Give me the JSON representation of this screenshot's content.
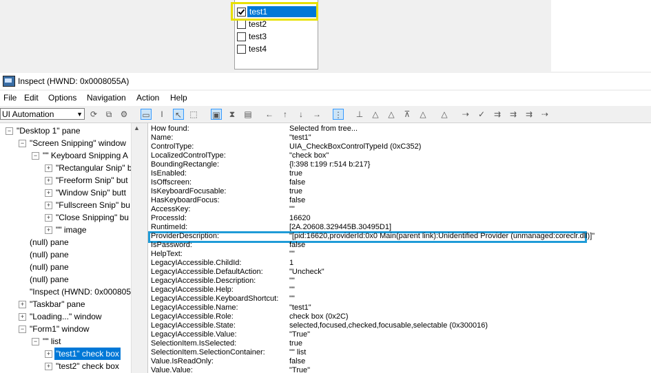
{
  "listbox": {
    "items": [
      {
        "label": "test1",
        "checked": true
      },
      {
        "label": "test2",
        "checked": false
      },
      {
        "label": "test3",
        "checked": false
      },
      {
        "label": "test4",
        "checked": false
      }
    ]
  },
  "window": {
    "title": "Inspect  (HWND: 0x0008055A)"
  },
  "menu": [
    "File",
    "Edit",
    "Options",
    "Navigation",
    "Action",
    "Help"
  ],
  "toolbar": {
    "mode": "UI Automation"
  },
  "tree": [
    {
      "label": "\"Desktop 1\" pane",
      "level": 0,
      "exp": "−"
    },
    {
      "label": "\"Screen Snipping\" window",
      "level": 1,
      "exp": "−"
    },
    {
      "label": "\"\" Keyboard Snipping A",
      "level": 2,
      "exp": "−"
    },
    {
      "label": "\"Rectangular Snip\" b",
      "level": 3,
      "exp": "+"
    },
    {
      "label": "\"Freeform Snip\" but",
      "level": 3,
      "exp": "+"
    },
    {
      "label": "\"Window Snip\" butt",
      "level": 3,
      "exp": "+"
    },
    {
      "label": "\"Fullscreen Snip\" bu",
      "level": 3,
      "exp": "+"
    },
    {
      "label": "\"Close Snipping\" bu",
      "level": 3,
      "exp": "+"
    },
    {
      "label": "\"\" image",
      "level": 3,
      "exp": "+"
    },
    {
      "label": "(null) pane",
      "level": 1,
      "exp": ""
    },
    {
      "label": "(null) pane",
      "level": 1,
      "exp": ""
    },
    {
      "label": "(null) pane",
      "level": 1,
      "exp": ""
    },
    {
      "label": "(null) pane",
      "level": 1,
      "exp": ""
    },
    {
      "label": "\"Inspect  (HWND: 0x000805",
      "level": 1,
      "exp": ""
    },
    {
      "label": "\"Taskbar\" pane",
      "level": 1,
      "exp": "+"
    },
    {
      "label": "\"Loading...\" window",
      "level": 1,
      "exp": "+"
    },
    {
      "label": "\"Form1\" window",
      "level": 1,
      "exp": "−"
    },
    {
      "label": "\"\" list",
      "level": 2,
      "exp": "−"
    },
    {
      "label": "\"test1\" check box",
      "level": 3,
      "exp": "+",
      "selected": true
    },
    {
      "label": "\"test2\" check box",
      "level": 3,
      "exp": "+"
    }
  ],
  "properties": [
    [
      "How found:",
      "Selected from tree..."
    ],
    [
      "Name:",
      "\"test1\""
    ],
    [
      "ControlType:",
      "UIA_CheckBoxControlTypeId (0xC352)"
    ],
    [
      "LocalizedControlType:",
      "\"check box\""
    ],
    [
      "BoundingRectangle:",
      "{l:398 t:199 r:514 b:217}"
    ],
    [
      "IsEnabled:",
      "true"
    ],
    [
      "IsOffscreen:",
      "false"
    ],
    [
      "IsKeyboardFocusable:",
      "true"
    ],
    [
      "HasKeyboardFocus:",
      "false"
    ],
    [
      "AccessKey:",
      "\"\""
    ],
    [
      "ProcessId:",
      "16620"
    ],
    [
      "RuntimeId:",
      "[2A.20608.329445B.30495D1]"
    ],
    [
      "ProviderDescription:",
      "\"[pid:16620,providerId:0x0 Main(parent link):Unidentified Provider (unmanaged:coreclr.dll)]\""
    ],
    [
      "IsPassword:",
      "false"
    ],
    [
      "HelpText:",
      "\"\""
    ],
    [
      "LegacyIAccessible.ChildId:",
      "1"
    ],
    [
      "LegacyIAccessible.DefaultAction:",
      "\"Uncheck\""
    ],
    [
      "LegacyIAccessible.Description:",
      "\"\""
    ],
    [
      "LegacyIAccessible.Help:",
      "\"\""
    ],
    [
      "LegacyIAccessible.KeyboardShortcut:",
      "\"\""
    ],
    [
      "LegacyIAccessible.Name:",
      "\"test1\""
    ],
    [
      "LegacyIAccessible.Role:",
      "check box (0x2C)"
    ],
    [
      "LegacyIAccessible.State:",
      "selected,focused,checked,focusable,selectable (0x300016)"
    ],
    [
      "LegacyIAccessible.Value:",
      "\"True\""
    ],
    [
      "SelectionItem.IsSelected:",
      "true"
    ],
    [
      "SelectionItem.SelectionContainer:",
      "\"\" list"
    ],
    [
      "Value.IsReadOnly:",
      "false"
    ],
    [
      "Value.Value:",
      "\"True\""
    ]
  ]
}
